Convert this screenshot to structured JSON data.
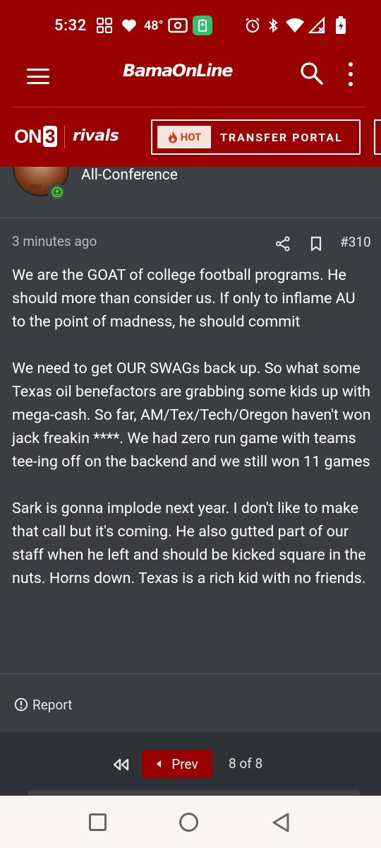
{
  "status_bar": {
    "time": "5:32",
    "temperature": "48°",
    "icons": [
      "grid-apps-icon",
      "heart-icon",
      "radio-icon",
      "battery-saver-icon",
      "alarm-icon",
      "bluetooth-icon",
      "wifi-icon",
      "signal-icon",
      "battery-charging-icon"
    ]
  },
  "header": {
    "logo": "BamaOnLine",
    "menu_icon": "hamburger-menu-icon",
    "search_icon": "search-icon",
    "more_icon": "more-vertical-icon"
  },
  "subnav": {
    "on3_prefix": "ON",
    "on3_number": "3",
    "rivals": "rivals",
    "hot_badge": "HOT",
    "transfer_portal": "TRANSFER PORTAL"
  },
  "user": {
    "title": "All-Conference",
    "avatar_text": "SNU"
  },
  "post": {
    "time": "3 minutes ago",
    "number": "#310",
    "paragraphs": [
      "We are the GOAT of college football programs. He should more than consider us. If only to inflame AU to the point of madness, he should commit",
      "We need to get OUR SWAGs back up. So what some Texas oil benefactors are grabbing some kids up with mega-cash. So far, AM/Tex/Tech/Oregon haven't won jack freakin ****. We had zero run game with teams tee-ing off on the backend and we still won 11 games",
      "Sark is gonna implode next year. I don't like to make that call but it's coming. He also gutted part of our staff when he left and should be kicked square in the nuts. Horns down. Texas is a rich kid with no friends."
    ],
    "report_label": "Report"
  },
  "pagination": {
    "prev_label": "Prev",
    "status": "8 of 8"
  },
  "colors": {
    "brand_red": "#990000",
    "background": "#3a3d42",
    "navbar": "#fbf5f3"
  }
}
